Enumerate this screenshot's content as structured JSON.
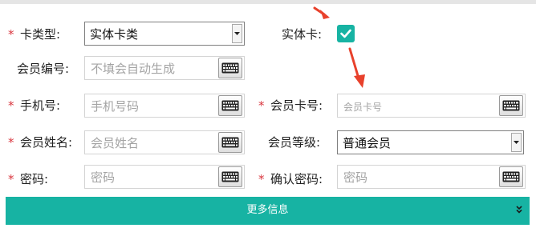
{
  "form": {
    "required_mark": "*",
    "card_type": {
      "label": "卡类型:",
      "value": "实体卡类"
    },
    "physical_card": {
      "label": "实体卡:",
      "checked": true
    },
    "member_id": {
      "label": "会员编号:",
      "placeholder": "不填会自动生成"
    },
    "phone": {
      "label": "手机号:",
      "placeholder": "手机号码"
    },
    "card_number": {
      "label": "会员卡号:",
      "placeholder": "会员卡号"
    },
    "member_name": {
      "label": "会员姓名:",
      "placeholder": "会员姓名"
    },
    "member_level": {
      "label": "会员等级:",
      "value": "普通会员"
    },
    "password": {
      "label": "密码:",
      "placeholder": "密码"
    },
    "confirm_password": {
      "label": "确认密码:",
      "placeholder": "密码"
    }
  },
  "more_info": {
    "label": "更多信息"
  },
  "icons": {
    "keyboard": "keyboard-icon",
    "dropdown": "triangle-down-icon",
    "check": "checkmark-icon",
    "expand": "double-chevron-down-icon",
    "annotation": "red-arrow"
  },
  "colors": {
    "accent": "#17b3a3",
    "required": "#d9363e",
    "annotation": "#e8412c"
  }
}
